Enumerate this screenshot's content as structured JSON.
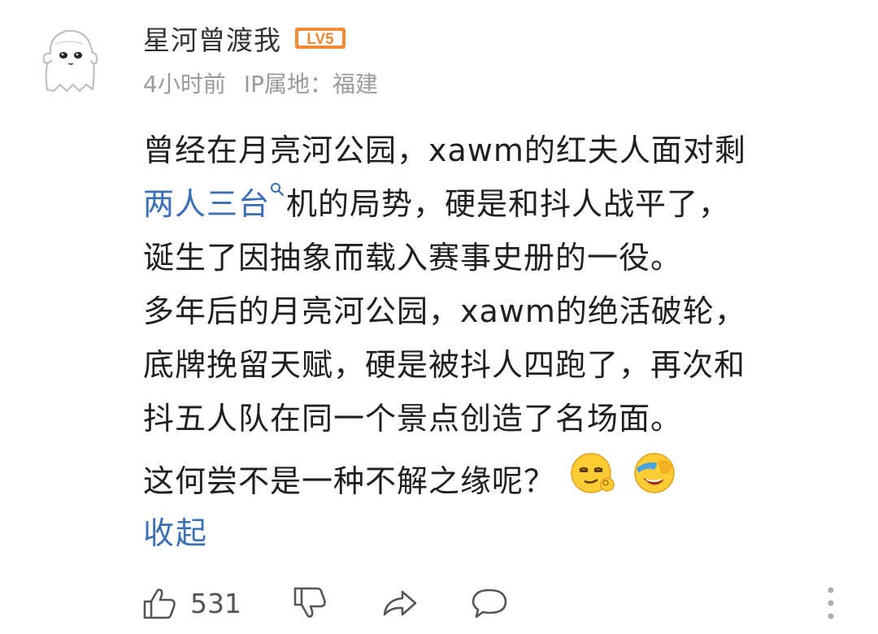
{
  "comment": {
    "author": {
      "name": "星河曾渡我",
      "level_badge": "LV5",
      "avatar_icon": "ghost-avatar-icon"
    },
    "meta": {
      "time": "4小时前",
      "ip_location": "IP属地：福建"
    },
    "body": {
      "line1": "曾经在月亮河公园，xawm的红夫人面对剩",
      "line2_link": "两人三台",
      "line2_rest": "机的局势，硬是和抖人战平了，",
      "line3": "诞生了因抽象而载入赛事史册的一役。",
      "line4": "多年后的月亮河公园，xawm的绝活破轮，",
      "line5": "底牌挽留天赋，硬是被抖人四跑了，再次和",
      "line6": "抖五人队在同一个景点创造了名场面。",
      "line7": "这何尝不是一种不解之缘呢？"
    },
    "emojis": [
      "smug-emoji-icon",
      "laughing-emoji-icon"
    ],
    "collapse_label": "收起",
    "actions": {
      "like_count": "531"
    }
  },
  "colors": {
    "link": "#3a6fb6",
    "text": "#1f1f1f",
    "meta": "#9a9a9a",
    "badge": "#f28a33"
  }
}
